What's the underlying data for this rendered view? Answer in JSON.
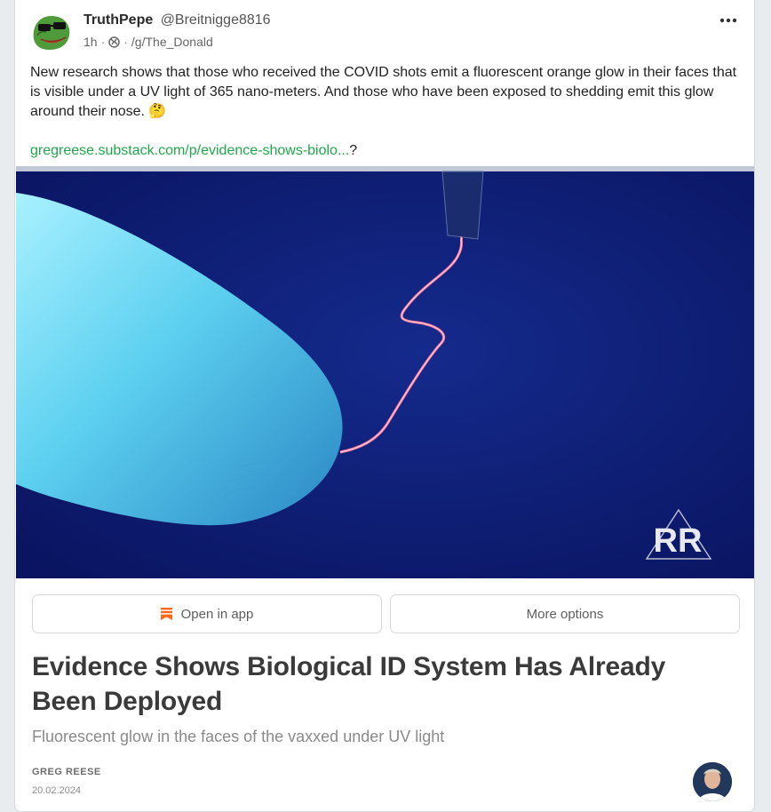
{
  "post": {
    "display_name": "TruthPepe",
    "handle": "@Breitnigge8816",
    "time_ago": "1h",
    "separator": "·",
    "community": "/g/The_Donald",
    "text": "New research shows that those who received the COVID shots emit a fluorescent orange glow in their faces that is visible under a UV light of 365 nano-meters. And those who have been exposed to shedding emit this glow around their nose. 🤔",
    "link_text": "gregreese.substack.com/p/evidence-shows-biolo...",
    "link_suffix": "?",
    "more_icon": "ellipsis-horizontal-icon"
  },
  "embed": {
    "open_in_app_label": "Open in app",
    "more_options_label": "More options",
    "article_title": "Evidence Shows Biological ID System Has Already Been Deployed",
    "article_subtitle": "Fluorescent glow in the faces of the vaxxed under UV light",
    "author": "GREG REESE",
    "date": "20.02.2024",
    "logo_text": "RR"
  },
  "colors": {
    "link": "#1fa84a",
    "uv_background": "#0d1a6e",
    "substack_orange": "#ff6719"
  }
}
